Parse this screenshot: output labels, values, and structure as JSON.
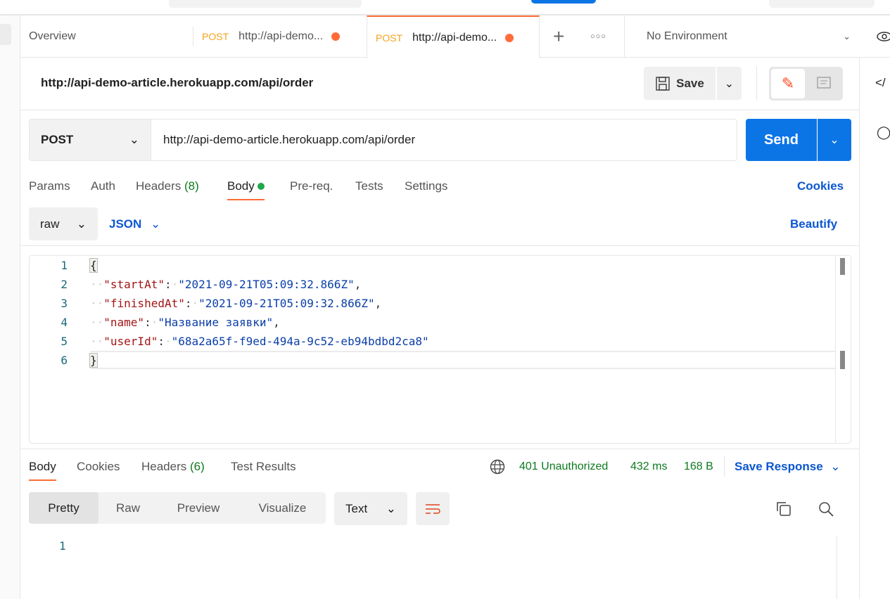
{
  "tabs": {
    "overview": "Overview",
    "tab1": {
      "method": "POST",
      "label": "http://api-demo..."
    },
    "tab2": {
      "method": "POST",
      "label": "http://api-demo..."
    },
    "environment": "No Environment"
  },
  "request": {
    "title": "http://api-demo-article.herokuapp.com/api/order",
    "save": "Save",
    "method": "POST",
    "url": "http://api-demo-article.herokuapp.com/api/order",
    "send": "Send"
  },
  "req_tabs": {
    "params": "Params",
    "auth": "Auth",
    "headers": "Headers",
    "headers_count": "(8)",
    "body": "Body",
    "prereq": "Pre-req.",
    "tests": "Tests",
    "settings": "Settings",
    "cookies": "Cookies"
  },
  "body_opts": {
    "mode": "raw",
    "format": "JSON",
    "beautify": "Beautify"
  },
  "editor": {
    "lines": [
      {
        "n": "1",
        "open": "{"
      },
      {
        "n": "2",
        "key": "\"startAt\"",
        "val": "\"2021-09-21T05:09:32.866Z\"",
        "end": ","
      },
      {
        "n": "3",
        "key": "\"finishedAt\"",
        "val": "\"2021-09-21T05:09:32.866Z\"",
        "end": ","
      },
      {
        "n": "4",
        "key": "\"name\"",
        "val": "\"Название заявки\"",
        "end": ","
      },
      {
        "n": "5",
        "key": "\"userId\"",
        "val": "\"68a2a65f-f9ed-494a-9c52-eb94bdbd2ca8\"",
        "end": ""
      },
      {
        "n": "6",
        "open": "}"
      }
    ]
  },
  "response": {
    "tabs": {
      "body": "Body",
      "cookies": "Cookies",
      "headers": "Headers",
      "headers_count": "(6)",
      "tests": "Test Results"
    },
    "status": "401 Unauthorized",
    "time": "432 ms",
    "size": "168 B",
    "save": "Save Response",
    "views": [
      "Pretty",
      "Raw",
      "Preview",
      "Visualize"
    ],
    "type": "Text",
    "line": "1"
  }
}
